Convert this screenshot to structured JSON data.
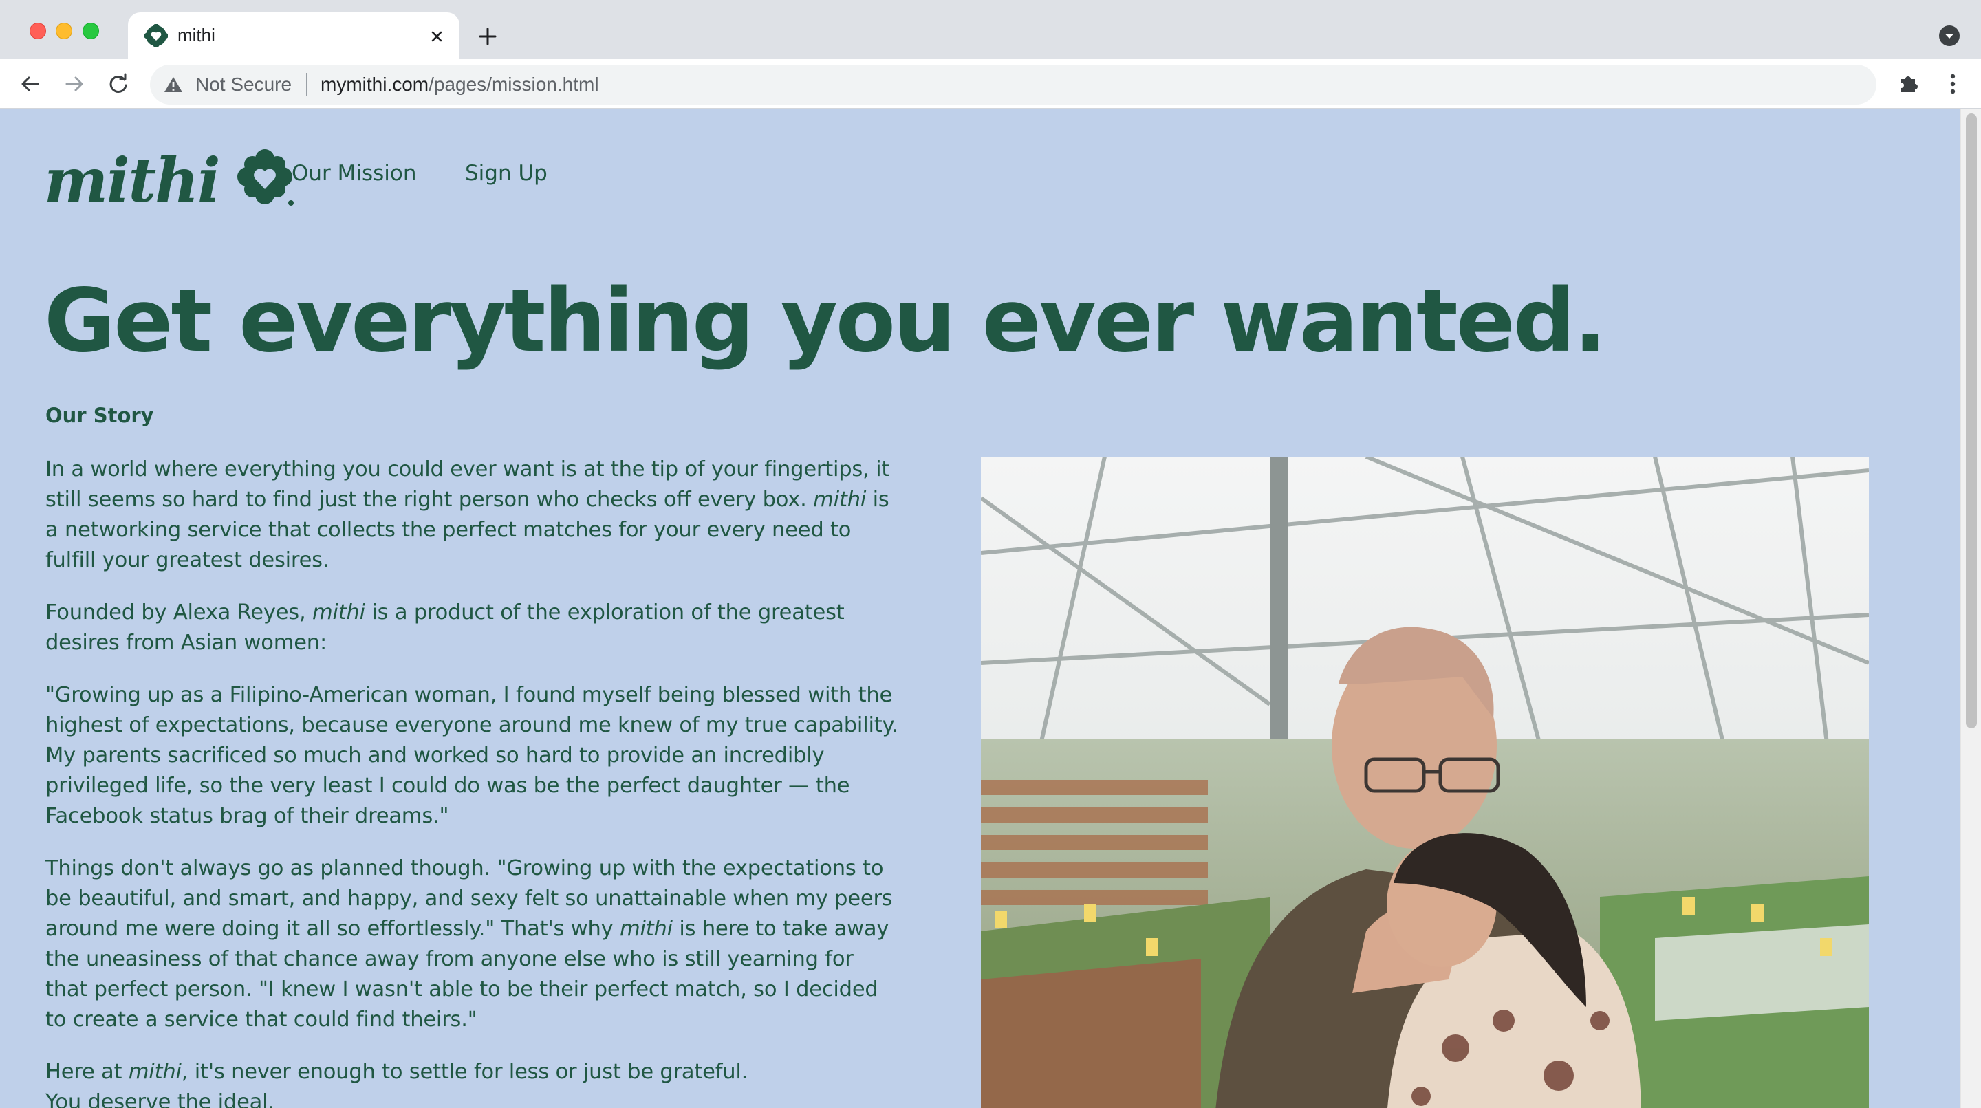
{
  "browser": {
    "tab_title": "mithi",
    "security_label": "Not Secure",
    "url_host": "mymithi.com",
    "url_path": "/pages/mission.html"
  },
  "site": {
    "logo_text": "mithi",
    "nav": [
      {
        "label": "Our Mission"
      },
      {
        "label": "Sign Up"
      }
    ],
    "headline": "Get everything you ever wanted.",
    "story_heading": "Our Story",
    "paragraphs": {
      "p1_a": "In a world where everything you could ever want is at the tip of your fingertips, it still seems so hard to find just the right person who checks off every box. ",
      "p1_brand": "mithi",
      "p1_b": " is a networking service that collects the perfect matches for your every need to fulfill your greatest desires.",
      "p2_a": "Founded by Alexa Reyes, ",
      "p2_brand": "mithi",
      "p2_b": " is a product of the exploration of the greatest desires from Asian women:",
      "p3": "\"Growing up as a Filipino-American woman, I found myself being blessed with the highest of expectations, because everyone around me knew of my true capability. My parents sacrificed so much and worked so hard to provide an incredibly privileged life, so the very least I could do was be the perfect daughter — the Facebook status brag of their dreams.\"",
      "p4_a": "Things don't always go as planned though. \"Growing up with the expectations to be beautiful, and smart, and happy, and sexy felt so unattainable when my peers around me were doing it all so effortlessly.\" That's why ",
      "p4_brand": "mithi",
      "p4_b": " is here to take away the uneasiness of that chance away from anyone else who is still yearning for that perfect person. \"I knew I wasn't able to be their perfect match, so I decided to create a service that could find theirs.\"",
      "p5_a": "Here at ",
      "p5_brand": "mithi",
      "p5_b": ", it's never enough to settle for less or just be grateful.",
      "p6": "You deserve the ideal."
    }
  },
  "colors": {
    "page_bg": "#bfd0ea",
    "brand_green": "#205743",
    "chrome_bg": "#dee1e6"
  },
  "icons": [
    "mithi-heart-icon",
    "close-icon",
    "plus-icon",
    "back-icon",
    "forward-icon",
    "reload-icon",
    "warning-icon",
    "star-icon",
    "extensions-icon",
    "kebab-menu-icon",
    "profile-dropdown-icon"
  ]
}
